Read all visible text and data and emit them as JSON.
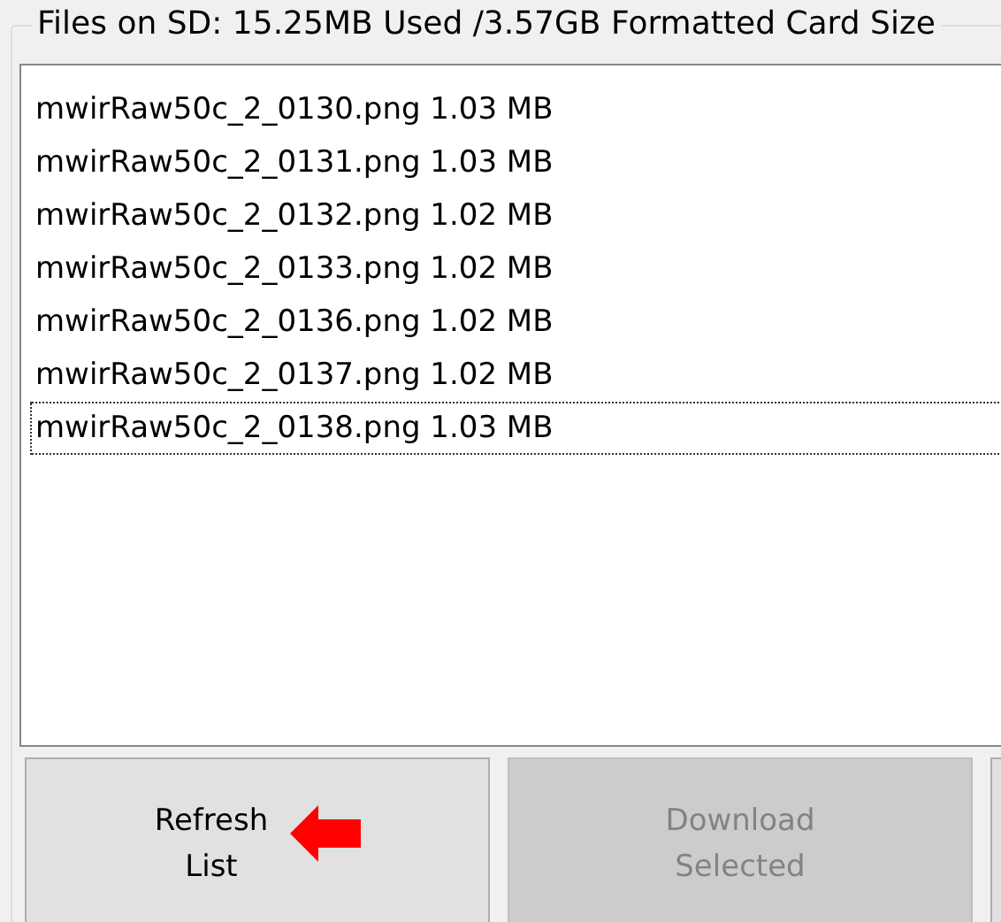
{
  "group": {
    "title": "Files on SD: 15.25MB Used /3.57GB Formatted Card Size"
  },
  "files": [
    {
      "label": "mwirRaw50c_2_0130.png 1.03 MB",
      "focused": false
    },
    {
      "label": "mwirRaw50c_2_0131.png 1.03 MB",
      "focused": false
    },
    {
      "label": "mwirRaw50c_2_0132.png 1.02 MB",
      "focused": false
    },
    {
      "label": "mwirRaw50c_2_0133.png 1.02 MB",
      "focused": false
    },
    {
      "label": "mwirRaw50c_2_0136.png 1.02 MB",
      "focused": false
    },
    {
      "label": "mwirRaw50c_2_0137.png 1.02 MB",
      "focused": false
    },
    {
      "label": "mwirRaw50c_2_0138.png 1.03 MB",
      "focused": true
    }
  ],
  "buttons": [
    {
      "label": "Refresh\nList",
      "disabled": false,
      "arrow": true
    },
    {
      "label": "Download\nSelected",
      "disabled": true,
      "arrow": false
    },
    {
      "disabled": false,
      "arrow": false
    }
  ]
}
